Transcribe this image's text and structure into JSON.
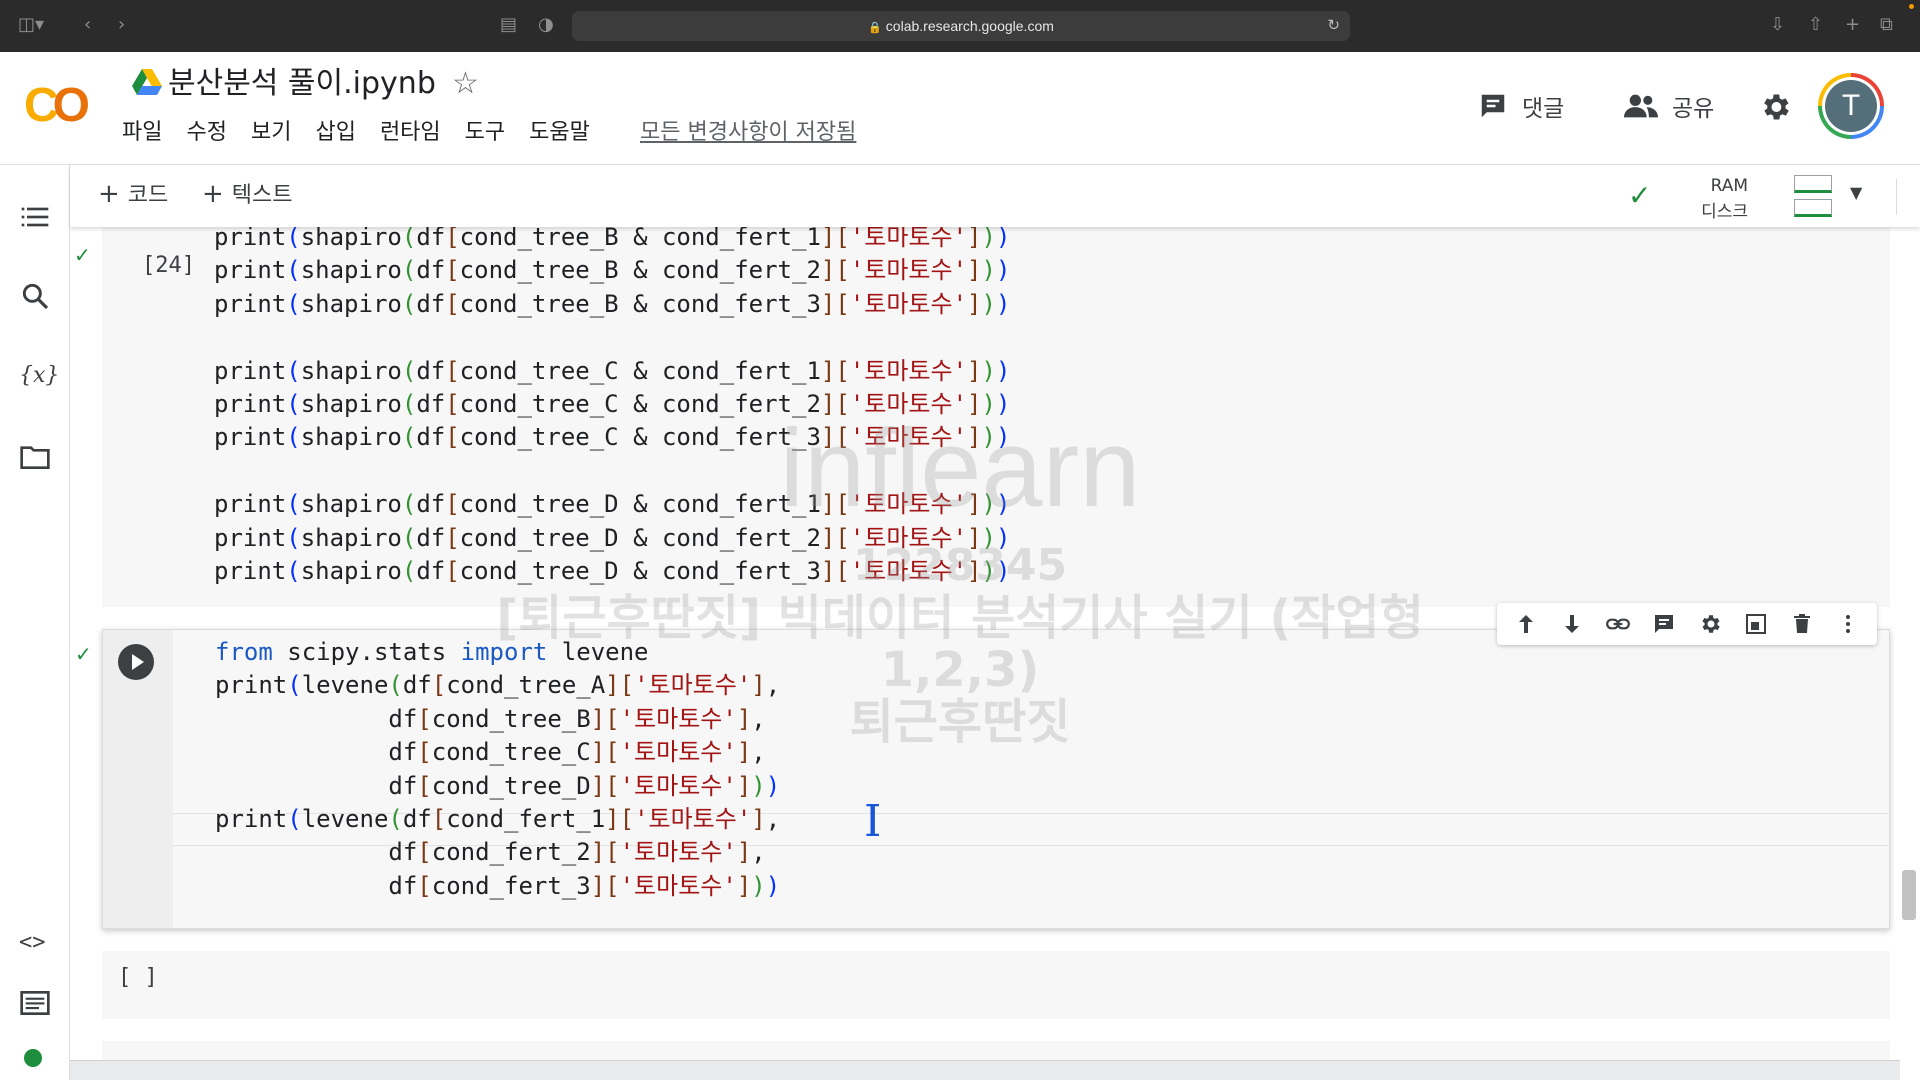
{
  "browser": {
    "url": "colab.research.google.com"
  },
  "header": {
    "logo_text": "CO",
    "notebook_title": "분산분석 풀이.ipynb",
    "menu": [
      "파일",
      "수정",
      "보기",
      "삽입",
      "런타임",
      "도구",
      "도움말"
    ],
    "save_status": "모든 변경사항이 저장됨",
    "comments_label": "댓글",
    "share_label": "공유",
    "avatar_initial": "T"
  },
  "toolbar": {
    "add_code_label": "코드",
    "add_text_label": "텍스트",
    "ram_label": "RAM",
    "disk_label": "디스크"
  },
  "cells": {
    "cell1": {
      "exec_count": "[24]",
      "lines": [
        {
          "obj": "cond_tree_B",
          "fert": "cond_fert_1",
          "key": "'토마토수'"
        },
        {
          "obj": "cond_tree_B",
          "fert": "cond_fert_2",
          "key": "'토마토수'"
        },
        {
          "obj": "cond_tree_B",
          "fert": "cond_fert_3",
          "key": "'토마토수'"
        },
        {
          "obj": "cond_tree_C",
          "fert": "cond_fert_1",
          "key": "'토마토수'"
        },
        {
          "obj": "cond_tree_C",
          "fert": "cond_fert_2",
          "key": "'토마토수'"
        },
        {
          "obj": "cond_tree_C",
          "fert": "cond_fert_3",
          "key": "'토마토수'"
        },
        {
          "obj": "cond_tree_D",
          "fert": "cond_fert_1",
          "key": "'토마토수'"
        },
        {
          "obj": "cond_tree_D",
          "fert": "cond_fert_2",
          "key": "'토마토수'"
        },
        {
          "obj": "cond_tree_D",
          "fert": "cond_fert_3",
          "key": "'토마토수'"
        }
      ]
    },
    "cell2": {
      "import_line": {
        "kw_from": "from",
        "module": "scipy.stats",
        "kw_import": "import",
        "name": "levene"
      },
      "levene1_args": [
        "cond_tree_A",
        "cond_tree_B",
        "cond_tree_C",
        "cond_tree_D"
      ],
      "levene2_args": [
        "cond_fert_1",
        "cond_fert_2",
        "cond_fert_3"
      ],
      "key": "'토마토수'"
    },
    "cell3": {
      "brackets": "[ ]"
    }
  },
  "watermark": {
    "logo": "inflearn",
    "id": "1228345",
    "course": "[퇴근후딴짓] 빅데이터 분석기사 실기 (작업형1,2,3)",
    "author": "퇴근후딴짓"
  },
  "icons": [
    "sidebar-toggle-icon",
    "back-icon",
    "forward-icon",
    "reload-icon",
    "download-icon",
    "share-sheet-icon",
    "new-tab-icon",
    "tabs-icon",
    "drive-icon",
    "star-icon",
    "comment-icon",
    "people-icon",
    "gear-icon",
    "toc-icon",
    "search-icon",
    "variables-icon",
    "folder-icon",
    "code-snippets-icon",
    "terminal-icon",
    "run-icon",
    "arrow-up-icon",
    "arrow-down-icon",
    "link-icon",
    "comment-icon",
    "gear-icon",
    "mirror-cell-icon",
    "trash-icon",
    "more-vert-icon"
  ],
  "colors": {
    "keyword": "#1a59c4",
    "string": "#a31515",
    "bracket_level1": "#0431fa",
    "bracket_level2": "#319331",
    "bracket_level3": "#7b3814",
    "status_green": "#1e8e3e",
    "logo_orange": "#f9ab00"
  }
}
